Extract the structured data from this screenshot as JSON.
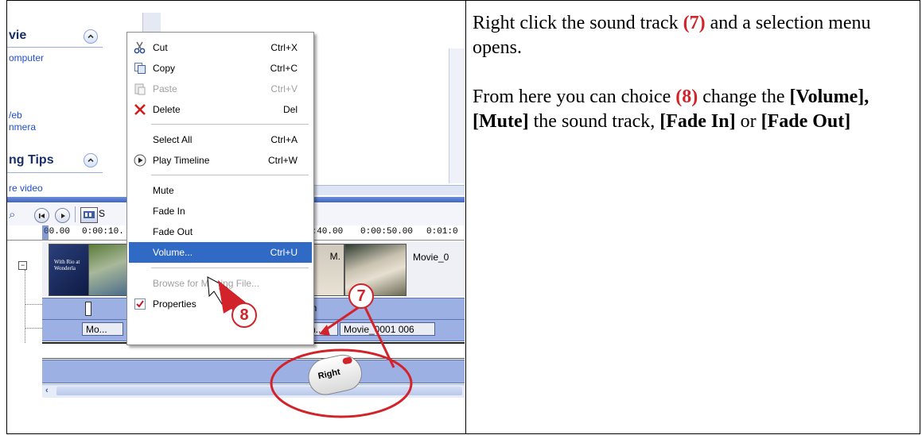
{
  "task_pane": {
    "section1_title": "vie",
    "section1_links": [
      "omputer",
      "/eb",
      "nmera"
    ],
    "section2_title": "ng Tips",
    "section2_link": "re video"
  },
  "toolbar": {
    "storyboard_label": "S"
  },
  "ruler": {
    "ticks": [
      "00.00",
      "0:00:10.",
      "0:40.00",
      "0:00:50.00",
      "0:01:0"
    ]
  },
  "timeline": {
    "video_clip_label": "M.",
    "video_clip2_label": "Movie_0",
    "title_clip_text": "With Rio at Wonderla",
    "audio_clips": [
      "Mo...",
      "Movie_0001 006"
    ],
    "audio_partial": "an",
    "audio_partial2": "h..."
  },
  "context_menu": {
    "items": [
      {
        "label": "Cut",
        "shortcut": "Ctrl+X",
        "icon": "scissors-icon",
        "disabled": false
      },
      {
        "label": "Copy",
        "shortcut": "Ctrl+C",
        "icon": "copy-icon",
        "disabled": false
      },
      {
        "label": "Paste",
        "shortcut": "Ctrl+V",
        "icon": "paste-icon",
        "disabled": true
      },
      {
        "label": "Delete",
        "shortcut": "Del",
        "icon": "delete-x-icon",
        "disabled": false
      },
      {
        "label": "Select All",
        "shortcut": "Ctrl+A",
        "icon": "",
        "disabled": false
      },
      {
        "label": "Play Timeline",
        "shortcut": "Ctrl+W",
        "icon": "play-icon",
        "disabled": false
      },
      {
        "label": "Mute",
        "shortcut": "",
        "icon": "",
        "disabled": false
      },
      {
        "label": "Fade In",
        "shortcut": "",
        "icon": "",
        "disabled": false
      },
      {
        "label": "Fade Out",
        "shortcut": "",
        "icon": "",
        "disabled": false
      },
      {
        "label": "Volume...",
        "shortcut": "Ctrl+U",
        "icon": "",
        "disabled": false,
        "selected": true
      },
      {
        "label": "Browse for Missing File...",
        "shortcut": "",
        "icon": "",
        "disabled": true
      },
      {
        "label": "Properties",
        "shortcut": "",
        "icon": "properties-check-icon",
        "disabled": false
      }
    ]
  },
  "callouts": {
    "seven": "7",
    "eight": "8",
    "mouse_label": "Right"
  },
  "colors": {
    "callout_red": "#d2232a",
    "menu_highlight": "#316ac5",
    "track_blue": "#9cb0e4"
  },
  "instructions": {
    "p1_before": "Right click the sound track ",
    "p1_num": "(7)",
    "p1_after": " and a selection menu opens.",
    "p2_before": "From here you can choice  ",
    "p2_num": "(8)",
    "p2_mid": " change the ",
    "p2_vol": "[Volume], [Mute]",
    "p2_mid2": " the sound track, ",
    "p2_fadein": "[Fade In]",
    "p2_or": " or ",
    "p2_fadeout": "[Fade Out]"
  }
}
